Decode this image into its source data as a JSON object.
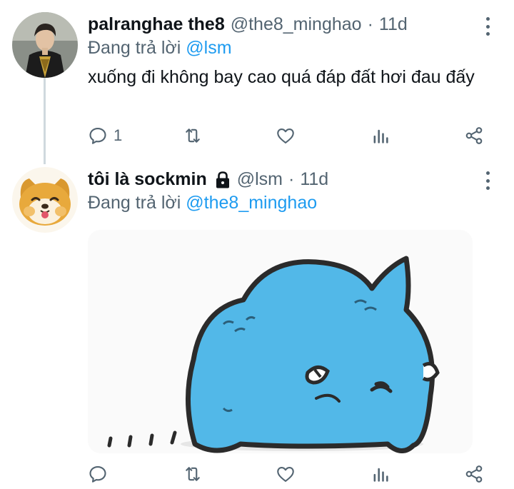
{
  "tweets": [
    {
      "display_name": "palranghae the8",
      "handle": "@the8_minghao",
      "separator": "·",
      "time": "11d",
      "replying_prefix": "Đang trả lời",
      "replying_to": "@lsm",
      "text": "xuống đi không bay cao quá đáp đất hơi đau đấy",
      "reply_count": "1",
      "avatar_icon": "avatar-photo-person",
      "protected": false
    },
    {
      "display_name": "tôi là sockmin",
      "handle": "@lsm",
      "separator": "·",
      "time": "11d",
      "replying_prefix": "Đang trả lời",
      "replying_to": "@the8_minghao",
      "text": "",
      "reply_count": "",
      "avatar_icon": "avatar-shiba-dog",
      "protected": true,
      "media": "image-blue-cartoon-cat"
    }
  ],
  "icons": {
    "reply": "reply-icon",
    "retweet": "retweet-icon",
    "like": "like-icon",
    "analytics": "analytics-icon",
    "share": "share-icon",
    "more": "more-icon",
    "lock": "lock-icon"
  },
  "colors": {
    "text": "#0f1419",
    "secondary": "#536471",
    "accent": "#1d9bf0",
    "thread_line": "#cfd9de",
    "cat": "#52b8e8"
  }
}
